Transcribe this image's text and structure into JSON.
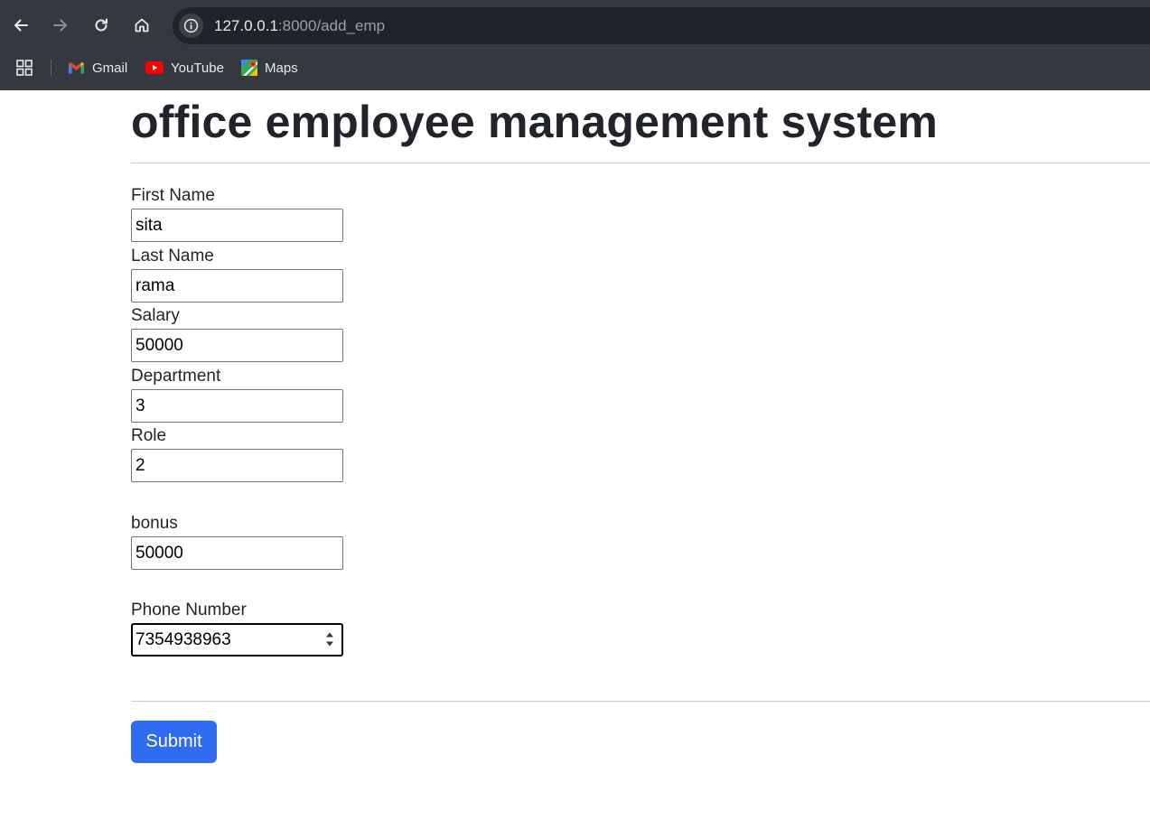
{
  "browser": {
    "url_host": "127.0.0.1",
    "url_path": ":8000/add_emp",
    "bookmarks": [
      {
        "label": "Gmail",
        "icon": "gmail-icon"
      },
      {
        "label": "YouTube",
        "icon": "youtube-icon"
      },
      {
        "label": "Maps",
        "icon": "maps-icon"
      }
    ]
  },
  "page": {
    "title": "office employee management system"
  },
  "form": {
    "first_name": {
      "label": "First Name",
      "value": "sita"
    },
    "last_name": {
      "label": "Last Name",
      "value": "rama"
    },
    "salary": {
      "label": "Salary",
      "value": "50000"
    },
    "department": {
      "label": "Department",
      "value": "3"
    },
    "role": {
      "label": "Role",
      "value": "2"
    },
    "bonus": {
      "label": "bonus",
      "value": "50000"
    },
    "phone": {
      "label": "Phone Number",
      "value": "7354938963"
    },
    "submit_label": "Submit"
  },
  "colors": {
    "chrome_bg": "#35393f",
    "omnibox_bg": "#202329",
    "submit_bg": "#2f6cf2",
    "heading_text": "#212529"
  }
}
